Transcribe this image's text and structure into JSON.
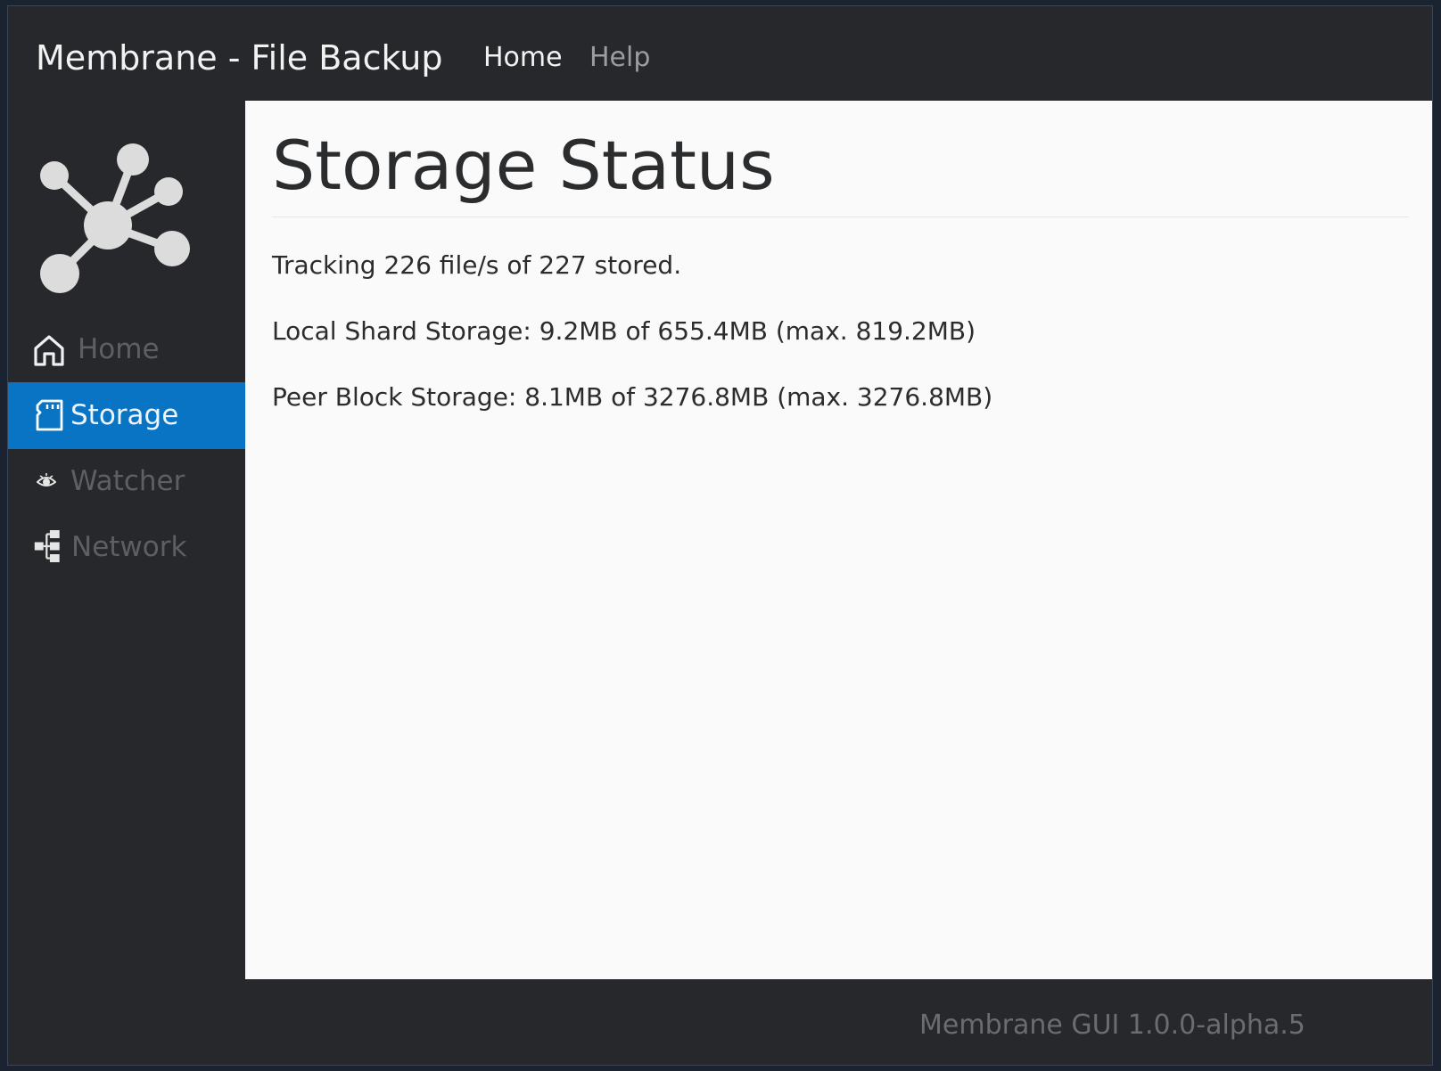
{
  "app": {
    "title": "Membrane - File Backup"
  },
  "topnav": {
    "home_label": "Home",
    "help_label": "Help"
  },
  "sidebar": {
    "logo_icon": "network-hub-icon",
    "items": [
      {
        "label": "Home",
        "icon": "home-icon",
        "active": false
      },
      {
        "label": "Storage",
        "icon": "sd-card-icon",
        "active": true
      },
      {
        "label": "Watcher",
        "icon": "eye-icon",
        "active": false
      },
      {
        "label": "Network",
        "icon": "sitemap-icon",
        "active": false
      }
    ]
  },
  "main": {
    "title": "Storage Status",
    "stats": [
      "Tracking 226 file/s of 227 stored.",
      "Local Shard Storage: 9.2MB of 655.4MB (max. 819.2MB)",
      "Peer Block Storage: 8.1MB of 3276.8MB (max. 3276.8MB)"
    ]
  },
  "footer": {
    "version": "Membrane GUI 1.0.0-alpha.5"
  },
  "colors": {
    "chrome_bg": "#26282b",
    "content_bg": "#fafafa",
    "accent": "#0a74c4",
    "muted_text": "#5d6063"
  }
}
